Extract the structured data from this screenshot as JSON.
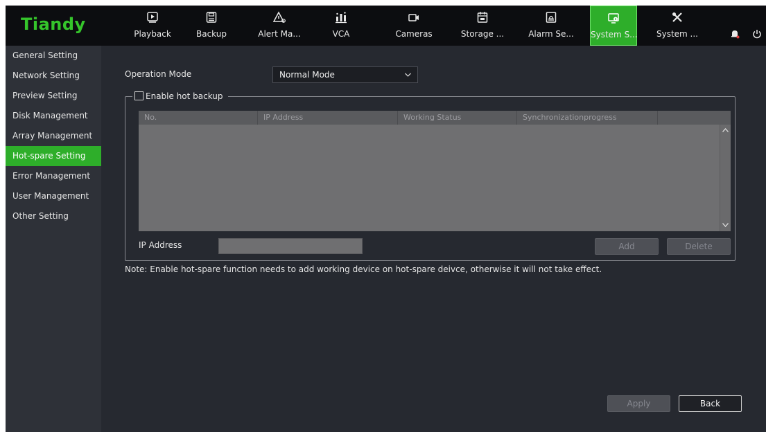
{
  "brand": {
    "logo": "Tiandy",
    "accent": "#35c52b",
    "active_color": "#2eae2a"
  },
  "topnav": [
    {
      "label": "Playback",
      "icon": "playback-icon"
    },
    {
      "label": "Backup",
      "icon": "save-icon"
    },
    {
      "label": "Alert Ma...",
      "icon": "alert-icon"
    },
    {
      "label": "VCA",
      "icon": "vca-icon"
    },
    {
      "label": "Cameras",
      "icon": "camera-icon"
    },
    {
      "label": "Storage ...",
      "icon": "storage-icon"
    },
    {
      "label": "Alarm Se...",
      "icon": "alarm-icon"
    },
    {
      "label": "System S...",
      "icon": "system-settings-icon",
      "active": true
    },
    {
      "label": "System ...",
      "icon": "tools-icon"
    }
  ],
  "sidebar": {
    "items": [
      {
        "label": "General Setting"
      },
      {
        "label": "Network Setting"
      },
      {
        "label": "Preview Setting"
      },
      {
        "label": "Disk Management"
      },
      {
        "label": "Array Management"
      },
      {
        "label": "Hot-spare Setting",
        "active": true
      },
      {
        "label": "Error Management"
      },
      {
        "label": "User Management"
      },
      {
        "label": "Other Setting"
      }
    ]
  },
  "main": {
    "operation_mode_label": "Operation Mode",
    "operation_mode_value": "Normal Mode",
    "hot_backup": {
      "checkbox_label": "Enable hot backup",
      "checked": false,
      "table": {
        "columns": [
          "No.",
          "IP Address",
          "Working Status",
          "Synchronizationprogress"
        ],
        "rows": []
      },
      "ip_label": "IP Address",
      "ip_value": "",
      "add_label": "Add",
      "delete_label": "Delete"
    },
    "note": "Note: Enable hot-spare function needs to add working device on hot-spare deivce, otherwise it will not take effect.",
    "apply_label": "Apply",
    "back_label": "Back"
  }
}
